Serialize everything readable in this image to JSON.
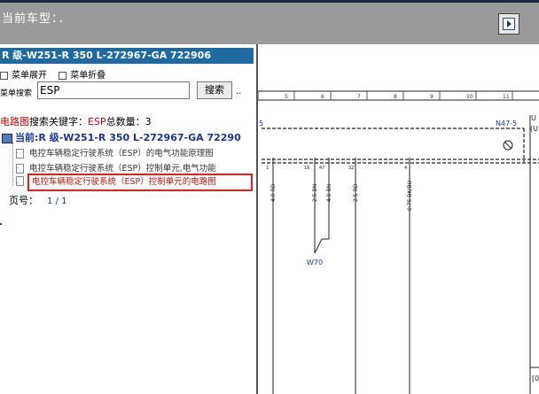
{
  "header": {
    "title": "当前车型：．",
    "exit_icon": "exit-icon"
  },
  "left_panel": {
    "vehicle": "R 级-W251-R 350 L-272967-GA 722906",
    "menu_expand": "菜单展开",
    "menu_collapse": "菜单折叠",
    "search_label": "菜单搜索",
    "search_value": "ESP",
    "search_button": "搜索",
    "search_extra": "..",
    "result_prefix": "电路图",
    "result_middle": "搜索关键字：",
    "result_keyword": "ESP",
    "result_total_label": "总数量：",
    "result_total": "3",
    "tree_root": "当前:R 级-W251-R 350 L-272967-GA 72290",
    "tree_items": [
      "电控车辆稳定行驶系统（ESP）的电气功能原理图",
      "电控车辆稳定行驶系统（ESP）控制单元,电气功能",
      "电控车辆稳定行驶系统（ESP）控制单元的电路图"
    ],
    "page_label": "页号：",
    "page_value": "1 / 1"
  },
  "diagram": {
    "ruler_numbers": [
      "5",
      "6",
      "7",
      "8",
      "9",
      "10",
      "11"
    ],
    "left_ref": "5",
    "component": "N47-5",
    "component_side_1": "U",
    "component_side_2": "(U",
    "pin_numbers": [
      "1",
      "16",
      "47",
      "32",
      "4"
    ],
    "wire_labels": [
      "4.0 RD",
      "2.5 BN",
      "4.0 BN",
      "2.5 RD",
      "0.75 BK/BU"
    ],
    "ground_label": "W70",
    "bottom_right": "[0"
  }
}
